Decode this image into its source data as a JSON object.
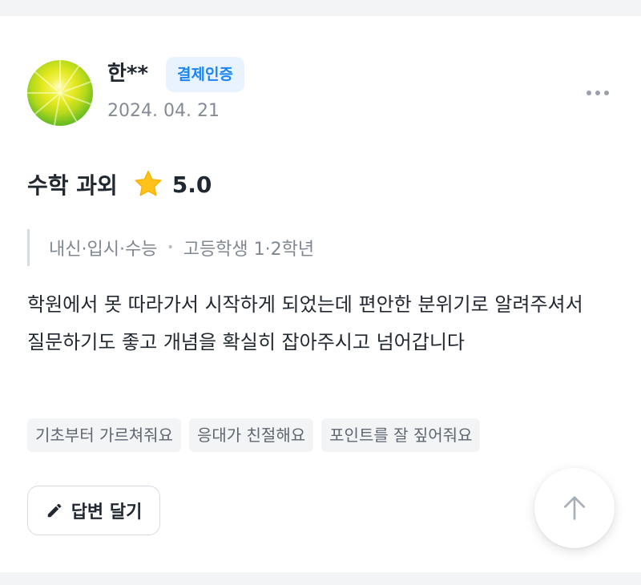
{
  "review": {
    "author": "한**",
    "verified_badge": "결제인증",
    "date": "2024. 04. 21",
    "subject": "수학 과외",
    "rating": "5.0",
    "categories": [
      "내신·입시·수능",
      "고등학생 1·2학년"
    ],
    "category_separator": "•",
    "body": "학원에서 못 따라가서 시작하게 되었는데 편안한 분위기로 알려주셔서 질문하기도 좋고 개념을 확실히 잡아주시고 넘어갑니다",
    "tags": [
      "기초부터 가르쳐줘요",
      "응대가 친절해요",
      "포인트를 잘 짚어줘요"
    ]
  },
  "actions": {
    "reply_label": "답변 달기",
    "more_icon": "more-horizontal-icon",
    "scroll_top_icon": "arrow-up-icon",
    "reply_icon": "pencil-icon"
  },
  "colors": {
    "badge_text": "#1b85f2",
    "badge_bg": "#e8f3ff",
    "star": "#ffc21a",
    "text_primary": "#222831",
    "text_secondary": "#848b95"
  }
}
